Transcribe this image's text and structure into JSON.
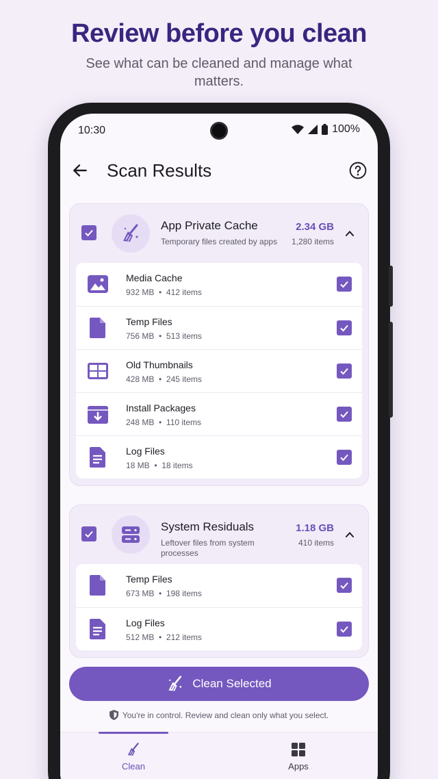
{
  "promo": {
    "headline": "Review before you clean",
    "subline": "See what can be cleaned and manage what matters."
  },
  "status_bar": {
    "time": "10:30",
    "battery": "100%"
  },
  "app_bar": {
    "title": "Scan Results"
  },
  "groups": [
    {
      "title": "App Private Cache",
      "subtitle": "Temporary files created by apps",
      "size": "2.34 GB",
      "count": "1,280 items",
      "icon": "broom-icon",
      "checked": true,
      "items": [
        {
          "name": "Media Cache",
          "size": "932 MB",
          "count": "412 items",
          "icon": "image-icon",
          "checked": true
        },
        {
          "name": "Temp Files",
          "size": "756 MB",
          "count": "513 items",
          "icon": "file-icon",
          "checked": true
        },
        {
          "name": "Old Thumbnails",
          "size": "428 MB",
          "count": "245 items",
          "icon": "grid-icon",
          "checked": true
        },
        {
          "name": "Install Packages",
          "size": "248 MB",
          "count": "110 items",
          "icon": "package-icon",
          "checked": true
        },
        {
          "name": "Log Files",
          "size": "18 MB",
          "count": "18 items",
          "icon": "document-icon",
          "checked": true
        }
      ]
    },
    {
      "title": "System Residuals",
      "subtitle": "Leftover files from system processes",
      "size": "1.18 GB",
      "count": "410 items",
      "icon": "server-icon",
      "checked": true,
      "items": [
        {
          "name": "Temp Files",
          "size": "673 MB",
          "count": "198 items",
          "icon": "file-icon",
          "checked": true
        },
        {
          "name": "Log Files",
          "size": "512 MB",
          "count": "212 items",
          "icon": "document-icon",
          "checked": true
        }
      ]
    }
  ],
  "actions": {
    "clean_label": "Clean Selected",
    "note": "You're in control. Review and clean only what you select."
  },
  "nav": {
    "clean": "Clean",
    "apps": "Apps",
    "active": "Clean"
  },
  "colors": {
    "accent": "#7458bf",
    "headline": "#3a2580",
    "background": "#f3eef8"
  }
}
